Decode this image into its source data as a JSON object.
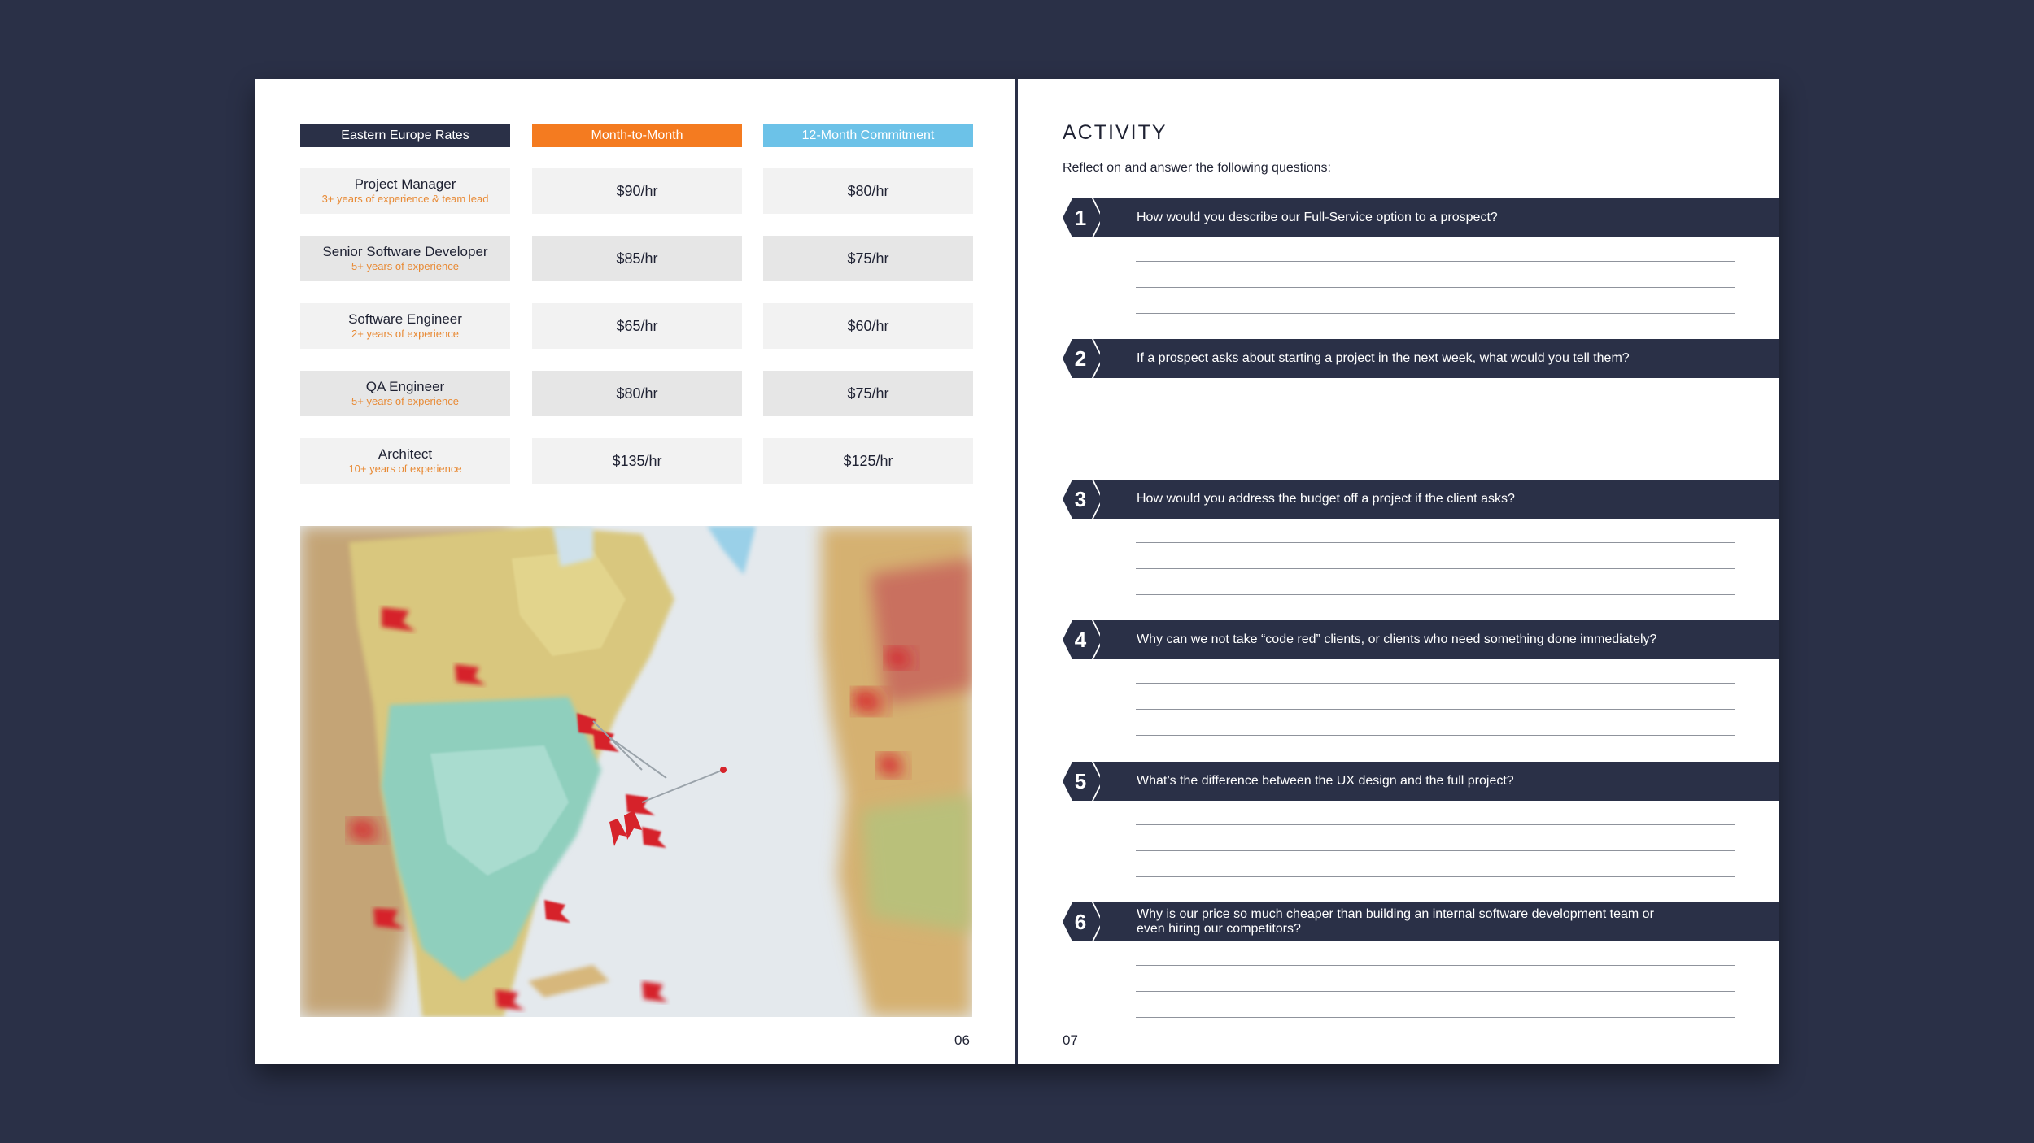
{
  "left_page": {
    "columns": [
      "Eastern Europe Rates",
      "Month-to-Month",
      "12-Month Commitment"
    ],
    "rows": [
      {
        "role": "Project Manager",
        "experience": "3+ years of experience & team lead",
        "month": "$90/hr",
        "commit": "$80/hr"
      },
      {
        "role": "Senior Software Developer",
        "experience": "5+ years of experience",
        "month": "$85/hr",
        "commit": "$75/hr"
      },
      {
        "role": "Software Engineer",
        "experience": "2+ years of experience",
        "month": "$65/hr",
        "commit": "$60/hr"
      },
      {
        "role": "QA Engineer",
        "experience": "5+ years of experience",
        "month": "$80/hr",
        "commit": "$75/hr"
      },
      {
        "role": "Architect",
        "experience": "10+ years of experience",
        "month": "$135/hr",
        "commit": "$125/hr"
      }
    ],
    "page_number": "06"
  },
  "right_page": {
    "title": "ACTIVITY",
    "intro": "Reflect on and answer the following questions:",
    "questions": [
      {
        "num": "1",
        "text": "How would you describe our Full-Service option to a prospect?"
      },
      {
        "num": "2",
        "text": "If a prospect asks about starting a project in the next week, what would you tell them?"
      },
      {
        "num": "3",
        "text": "How would you address the budget off a project if the client asks?"
      },
      {
        "num": "4",
        "text": "Why can we not take “code red” clients, or clients who need something done immediately?"
      },
      {
        "num": "5",
        "text": "What’s the difference between the UX design and the full project?"
      },
      {
        "num": "6",
        "text": "Why is our price so much cheaper than building an internal software development team or even hiring our competitors?"
      }
    ],
    "page_number": "07"
  },
  "colors": {
    "navy": "#2a3047",
    "orange": "#f47b20",
    "sky_blue": "#6cc2e8",
    "experience_text": "#e88a35"
  }
}
